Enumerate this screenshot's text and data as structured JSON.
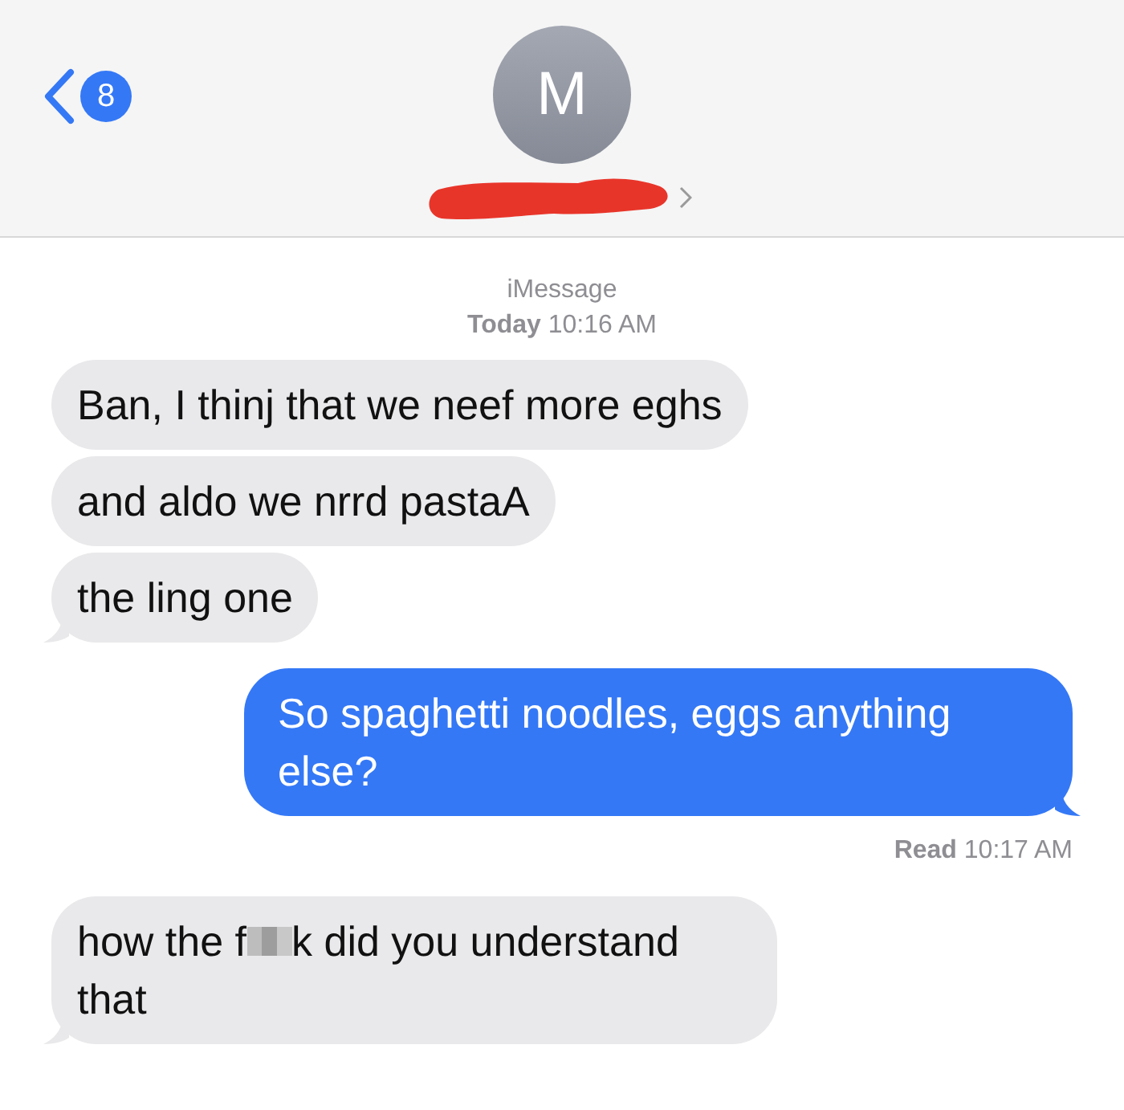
{
  "header": {
    "unread_count": "8",
    "avatar_initial": "M",
    "name_redacted": true
  },
  "thread_info": {
    "service": "iMessage",
    "time": "**Today** 10:16 AM"
  },
  "messages": [
    {
      "kind": "received",
      "tail": false,
      "segments": [
        {
          "kind": "text",
          "text": "Ban, I thinj that we neef more eghs"
        }
      ]
    },
    {
      "kind": "received",
      "tail": false,
      "segments": [
        {
          "kind": "text",
          "text": "and aldo we nrrd pastaA"
        }
      ]
    },
    {
      "kind": "received",
      "tail": true,
      "segments": [
        {
          "kind": "text",
          "text": "the ling one"
        }
      ]
    },
    {
      "kind": "sent",
      "tail": true,
      "segments": [
        {
          "kind": "text",
          "text": "So spaghetti noodles, eggs anything else?"
        }
      ],
      "receipt": "**Read** 10:17 AM"
    },
    {
      "kind": "received",
      "tail": true,
      "segments": [
        {
          "kind": "text",
          "text": "how the f"
        },
        {
          "kind": "censored"
        },
        {
          "kind": "text",
          "text": "k did you understand that"
        }
      ]
    }
  ]
}
